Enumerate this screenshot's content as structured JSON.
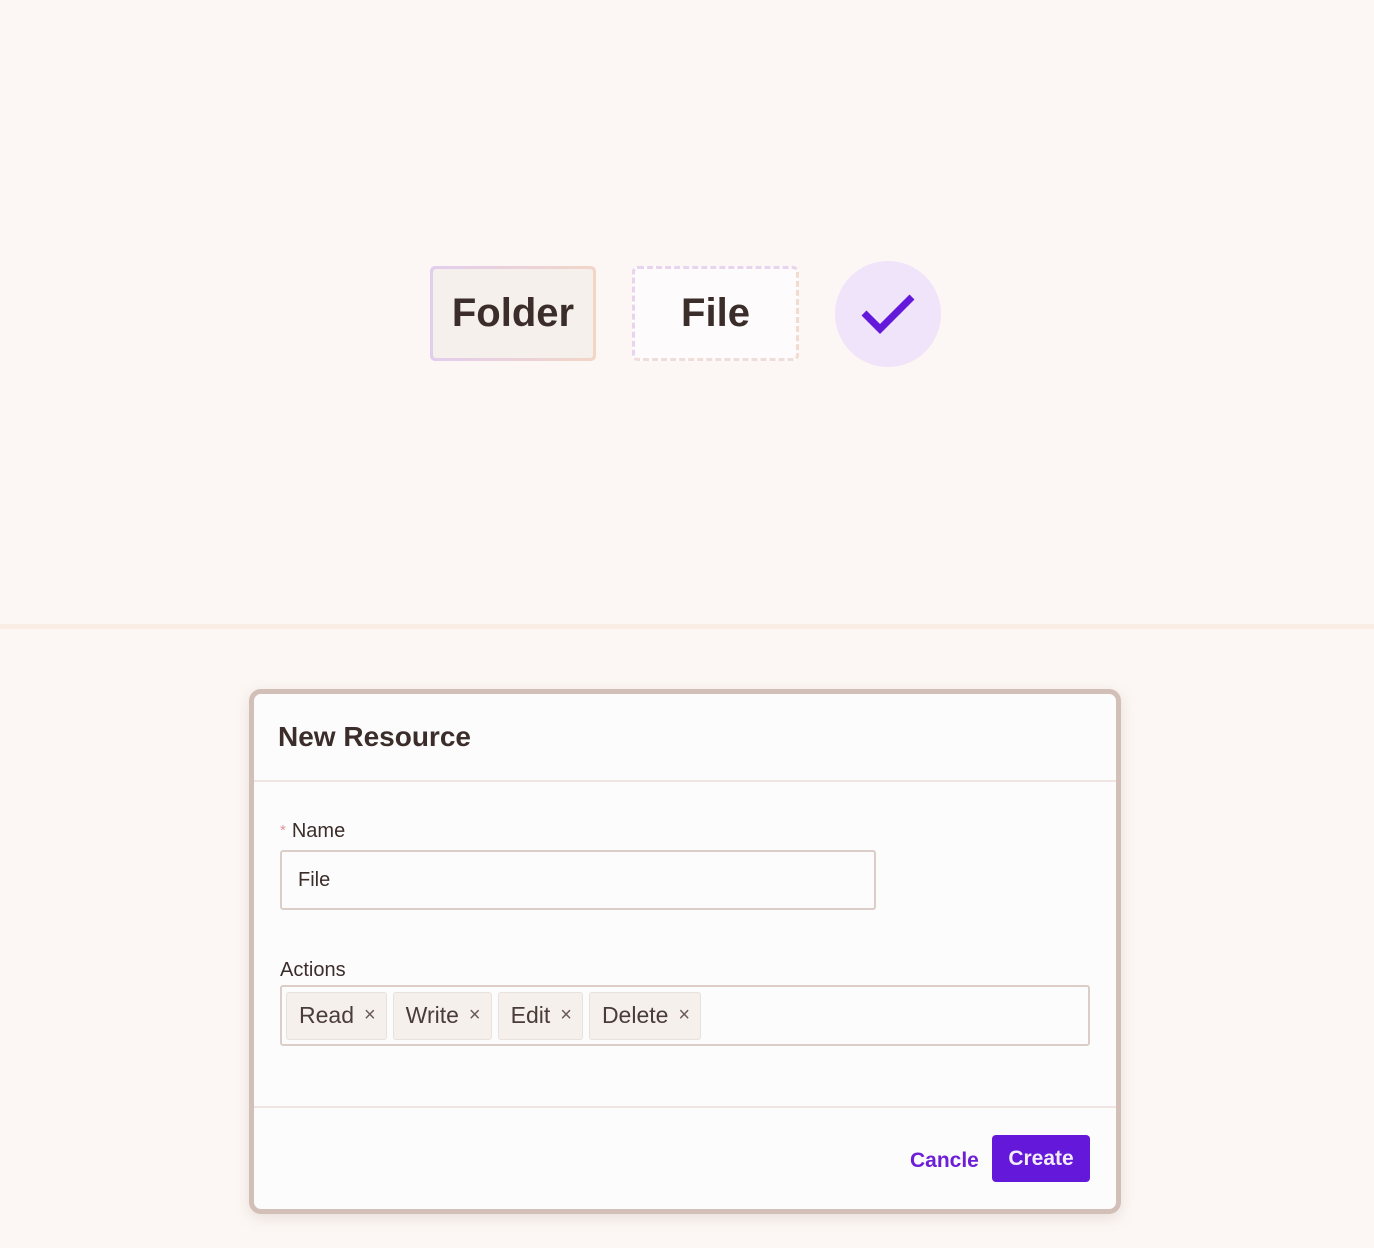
{
  "preview": {
    "folder_label": "Folder",
    "file_label": "File",
    "check_icon": "checkmark-icon"
  },
  "dialog": {
    "title": "New Resource",
    "name_field": {
      "label": "Name",
      "required_marker": "*",
      "value": "File"
    },
    "actions_field": {
      "label": "Actions",
      "tags": [
        {
          "label": "Read",
          "remove": "×"
        },
        {
          "label": "Write",
          "remove": "×"
        },
        {
          "label": "Edit",
          "remove": "×"
        },
        {
          "label": "Delete",
          "remove": "×"
        }
      ]
    },
    "cancel_label": "Cancle",
    "create_label": "Create"
  },
  "colors": {
    "accent": "#6318da",
    "background": "#fcf7f4",
    "text": "#3b2d2a"
  }
}
